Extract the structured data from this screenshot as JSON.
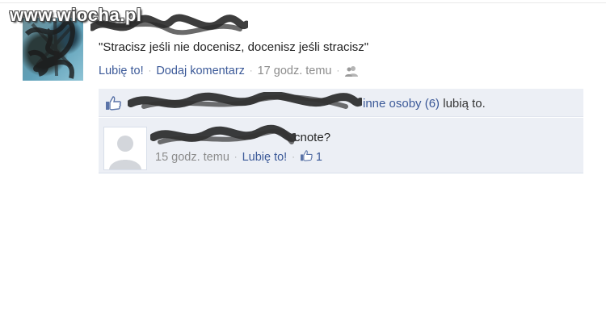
{
  "watermark": "www.wiocha.pl",
  "post": {
    "status": "\"Stracisz jeśli nie docenisz, docenisz jeśli stracisz\"",
    "like_label": "Lubię to!",
    "comment_label": "Dodaj komentarz",
    "time": "17 godz. temu"
  },
  "likes": {
    "text_link": "inne osoby (6)",
    "text_tail": " lubią to."
  },
  "comment": {
    "text": "cnote?",
    "time": "15 godz. temu",
    "like_label": "Lubię to!",
    "like_count": "1"
  },
  "icons": {
    "like": "thumbs-up-icon",
    "audience": "friends-icon",
    "default_avatar": "default-avatar-icon"
  },
  "colors": {
    "link": "#3b5998",
    "box": "#eceff5",
    "meta": "#8c8c8c"
  }
}
